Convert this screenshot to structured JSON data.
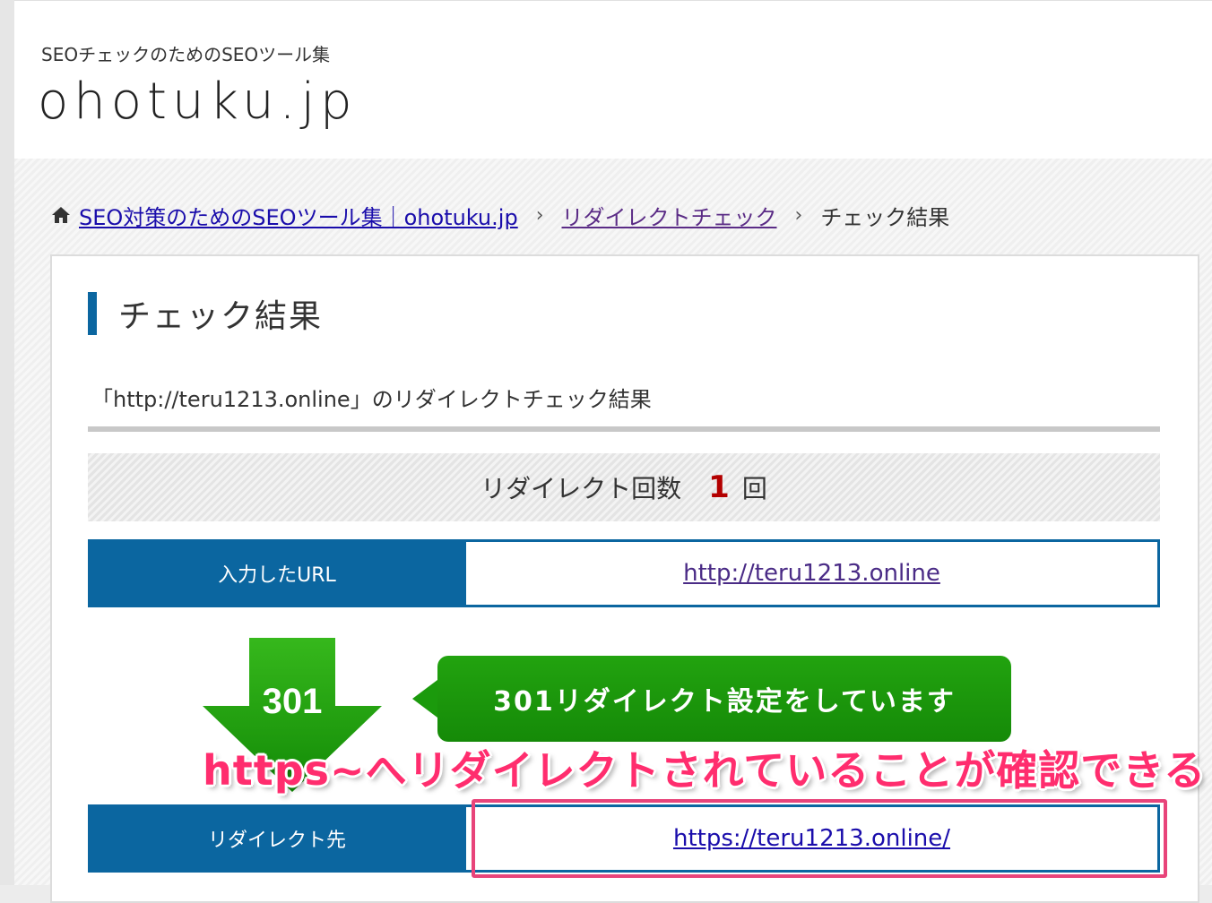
{
  "header": {
    "tagline": "SEOチェックのためのSEOツール集",
    "logo": "ohotuku.jp"
  },
  "breadcrumb": {
    "home_label": "SEO対策のためのSEOツール集｜ohotuku.jp",
    "level2_label": "リダイレクトチェック",
    "current_label": "チェック結果",
    "separator": "›"
  },
  "main": {
    "title": "チェック結果",
    "description": "「http://teru1213.online」のリダイレクトチェック結果",
    "redirect_count_label": "リダイレクト回数",
    "redirect_count": "1",
    "redirect_count_unit": "回",
    "input_url_label": "入力したURL",
    "input_url": "http://teru1213.online",
    "status_code": "301",
    "status_message": "301リダイレクト設定をしています",
    "redirect_to_label": "リダイレクト先",
    "redirect_to_url": "https://teru1213.online/"
  },
  "annotation": {
    "text": "https~へリダイレクトされていることが確認できる"
  },
  "colors": {
    "accent_blue": "#0b66a0",
    "arrow_green": "#1b9a0c",
    "annotation_pink": "#ff2d6e"
  }
}
